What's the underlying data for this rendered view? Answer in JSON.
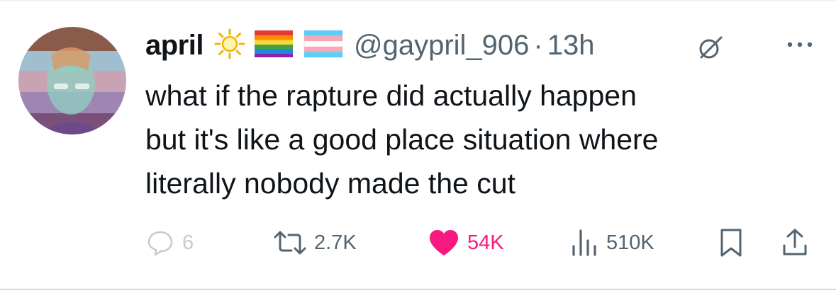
{
  "tweet": {
    "author": {
      "display_name": "april",
      "emojis": [
        "sun-emoji",
        "rainbow-flag-emoji",
        "trans-flag-emoji"
      ],
      "handle": "@gaypril_906",
      "separator": "·",
      "time": "13h"
    },
    "text_lines": [
      "what if the rapture did actually happen",
      "but it's like a good place situation where",
      "literally nobody made the cut"
    ],
    "stats": {
      "replies": "6",
      "reposts": "2.7K",
      "likes": "54K",
      "views": "510K"
    },
    "colors": {
      "text": "#0f1419",
      "secondary": "#536471",
      "like": "#f91880",
      "faded": "#c4ccd2"
    }
  }
}
